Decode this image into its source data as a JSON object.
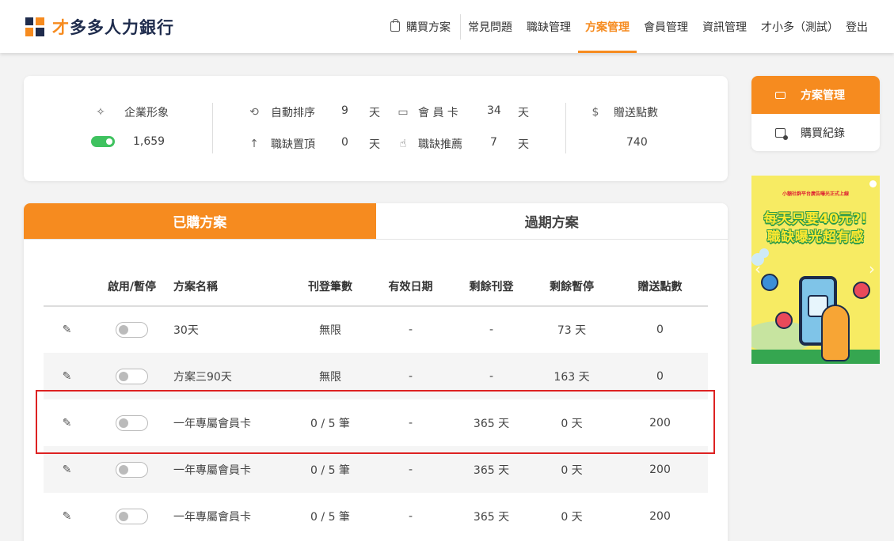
{
  "brand": {
    "accent_char": "才",
    "name_rest": "多多人力銀行"
  },
  "nav": {
    "buy_plan": "購買方案",
    "faq": "常見問題",
    "jobs": "職缺管理",
    "plans": "方案管理",
    "members": "會員管理",
    "info": "資訊管理",
    "user": "才小多（測試）",
    "logout": "登出"
  },
  "stats": {
    "image_label": "企業形象",
    "image_value": "1,659",
    "auto_sort_label": "自動排序",
    "auto_sort_value": "9",
    "pin_label": "職缺置頂",
    "pin_value": "0",
    "member_card_label": "會 員 卡",
    "member_card_value": "34",
    "recommend_label": "職缺推薦",
    "recommend_value": "7",
    "day_unit": "天",
    "gift_points_label": "贈送點數",
    "gift_points_value": "740"
  },
  "tabs": {
    "purchased": "已購方案",
    "expired": "過期方案"
  },
  "table": {
    "headers": [
      "啟用/暫停",
      "方案名稱",
      "刊登筆數",
      "有效日期",
      "剩餘刊登",
      "剩餘暫停",
      "贈送點數"
    ],
    "rows": [
      {
        "name": "30天",
        "count": "無限",
        "valid": "-",
        "remain_post": "-",
        "remain_pause": "73 天",
        "points": "0"
      },
      {
        "name": "方案三90天",
        "count": "無限",
        "valid": "-",
        "remain_post": "-",
        "remain_pause": "163 天",
        "points": "0"
      },
      {
        "name": "一年專屬會員卡",
        "count": "0 / 5 筆",
        "valid": "-",
        "remain_post": "365 天",
        "remain_pause": "0 天",
        "points": "200"
      },
      {
        "name": "一年專屬會員卡",
        "count": "0 / 5 筆",
        "valid": "-",
        "remain_post": "365 天",
        "remain_pause": "0 天",
        "points": "200"
      },
      {
        "name": "一年專屬會員卡",
        "count": "0 / 5 筆",
        "valid": "-",
        "remain_post": "365 天",
        "remain_pause": "0 天",
        "points": "200"
      }
    ]
  },
  "side": {
    "plan_management": "方案管理",
    "purchase_records": "購買紀錄"
  },
  "ad": {
    "small": "小額社群平台廣告曝光正式上線",
    "line1": "每天只要40元?!",
    "line2": "職缺曝光超有感"
  },
  "colors": {
    "accent": "#f68b1f",
    "navy": "#1f2c4d",
    "toggle_on": "#3fc25f",
    "highlight": "#dd2222"
  }
}
